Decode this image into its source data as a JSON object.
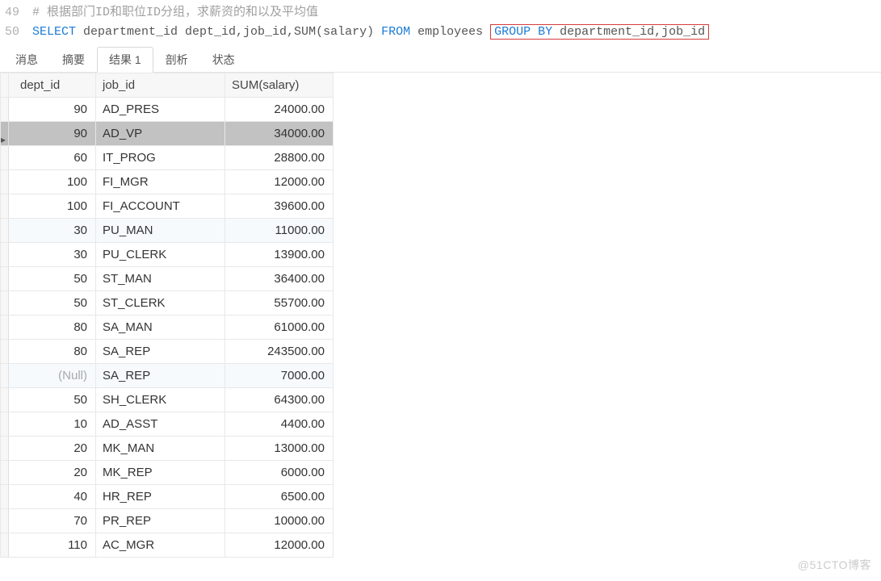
{
  "code": {
    "lines": [
      {
        "num": "49",
        "segments": [
          {
            "cls": "cmt",
            "text": "# 根据部门ID和职位ID分组，求薪资的和以及平均值"
          }
        ]
      },
      {
        "num": "50",
        "segments": [
          {
            "cls": "kw",
            "text": "SELECT"
          },
          {
            "cls": "plain",
            "text": " department_id dept_id,job_id,SUM(salary) "
          },
          {
            "cls": "kw",
            "text": "FROM"
          },
          {
            "cls": "plain",
            "text": " employees "
          },
          {
            "cls": "kw",
            "text": "GROUP BY",
            "boxed": true
          },
          {
            "cls": "plain",
            "text": " department_id,job_id",
            "boxed": true
          }
        ]
      }
    ]
  },
  "tabs": {
    "items": [
      {
        "label": "消息",
        "active": false
      },
      {
        "label": "摘要",
        "active": false
      },
      {
        "label": "结果 1",
        "active": true
      },
      {
        "label": "剖析",
        "active": false
      },
      {
        "label": "状态",
        "active": false
      }
    ]
  },
  "table": {
    "columns": [
      "dept_id",
      "job_id",
      "SUM(salary)"
    ],
    "rows": [
      {
        "dept": "90",
        "job": "AD_PRES",
        "sum": "24000.00",
        "sel": false,
        "alt": false
      },
      {
        "dept": "90",
        "job": "AD_VP",
        "sum": "34000.00",
        "sel": true,
        "alt": false
      },
      {
        "dept": "60",
        "job": "IT_PROG",
        "sum": "28800.00",
        "sel": false,
        "alt": false
      },
      {
        "dept": "100",
        "job": "FI_MGR",
        "sum": "12000.00",
        "sel": false,
        "alt": false
      },
      {
        "dept": "100",
        "job": "FI_ACCOUNT",
        "sum": "39600.00",
        "sel": false,
        "alt": false
      },
      {
        "dept": "30",
        "job": "PU_MAN",
        "sum": "11000.00",
        "sel": false,
        "alt": true
      },
      {
        "dept": "30",
        "job": "PU_CLERK",
        "sum": "13900.00",
        "sel": false,
        "alt": false
      },
      {
        "dept": "50",
        "job": "ST_MAN",
        "sum": "36400.00",
        "sel": false,
        "alt": false
      },
      {
        "dept": "50",
        "job": "ST_CLERK",
        "sum": "55700.00",
        "sel": false,
        "alt": false
      },
      {
        "dept": "80",
        "job": "SA_MAN",
        "sum": "61000.00",
        "sel": false,
        "alt": false
      },
      {
        "dept": "80",
        "job": "SA_REP",
        "sum": "243500.00",
        "sel": false,
        "alt": false
      },
      {
        "dept": "(Null)",
        "job": "SA_REP",
        "sum": "7000.00",
        "sel": false,
        "alt": true,
        "isnull": true
      },
      {
        "dept": "50",
        "job": "SH_CLERK",
        "sum": "64300.00",
        "sel": false,
        "alt": false
      },
      {
        "dept": "10",
        "job": "AD_ASST",
        "sum": "4400.00",
        "sel": false,
        "alt": false
      },
      {
        "dept": "20",
        "job": "MK_MAN",
        "sum": "13000.00",
        "sel": false,
        "alt": false
      },
      {
        "dept": "20",
        "job": "MK_REP",
        "sum": "6000.00",
        "sel": false,
        "alt": false
      },
      {
        "dept": "40",
        "job": "HR_REP",
        "sum": "6500.00",
        "sel": false,
        "alt": false
      },
      {
        "dept": "70",
        "job": "PR_REP",
        "sum": "10000.00",
        "sel": false,
        "alt": false
      },
      {
        "dept": "110",
        "job": "AC_MGR",
        "sum": "12000.00",
        "sel": false,
        "alt": false
      }
    ]
  },
  "watermark": "@51CTO博客"
}
